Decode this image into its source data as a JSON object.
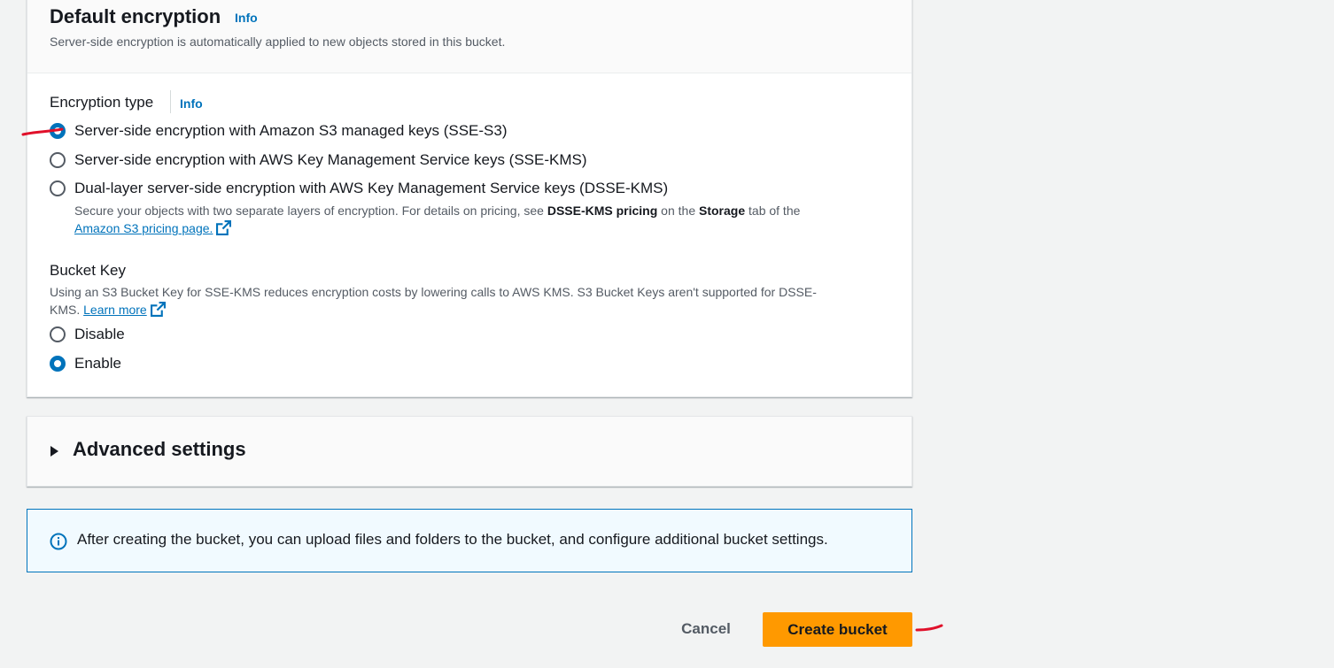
{
  "encryption": {
    "title": "Default encryption",
    "info_label": "Info",
    "description": "Server-side encryption is automatically applied to new objects stored in this bucket.",
    "type_label": "Encryption type",
    "type_info_label": "Info",
    "options": [
      {
        "label": "Server-side encryption with Amazon S3 managed keys (SSE-S3)",
        "selected": true
      },
      {
        "label": "Server-side encryption with AWS Key Management Service keys (SSE-KMS)",
        "selected": false
      },
      {
        "label": "Dual-layer server-side encryption with AWS Key Management Service keys (DSSE-KMS)",
        "selected": false
      }
    ],
    "dsse_desc_prefix": "Secure your objects with two separate layers of encryption. For details on pricing, see ",
    "dsse_desc_bold1": "DSSE-KMS pricing",
    "dsse_desc_mid": " on the ",
    "dsse_desc_bold2": "Storage",
    "dsse_desc_suffix": " tab of the",
    "dsse_link": "Amazon S3 pricing page.",
    "bucket_key": {
      "label": "Bucket Key",
      "desc_line1": "Using an S3 Bucket Key for SSE-KMS reduces encryption costs by lowering calls to AWS KMS. S3 Bucket Keys aren't supported for DSSE-",
      "desc_line2": "KMS.",
      "learn_more": "Learn more",
      "options": [
        {
          "label": "Disable",
          "selected": false
        },
        {
          "label": "Enable",
          "selected": true
        }
      ]
    }
  },
  "advanced": {
    "title": "Advanced settings"
  },
  "alert": {
    "text": "After creating the bucket, you can upload files and folders to the bucket, and configure additional bucket settings."
  },
  "footer": {
    "cancel_label": "Cancel",
    "create_label": "Create bucket"
  },
  "colors": {
    "accent": "#0073bb",
    "primary_button": "#ff9900",
    "annotation": "#e0102a"
  },
  "icons": [
    "external-link-icon",
    "info-circle-icon",
    "caret-right-icon"
  ]
}
